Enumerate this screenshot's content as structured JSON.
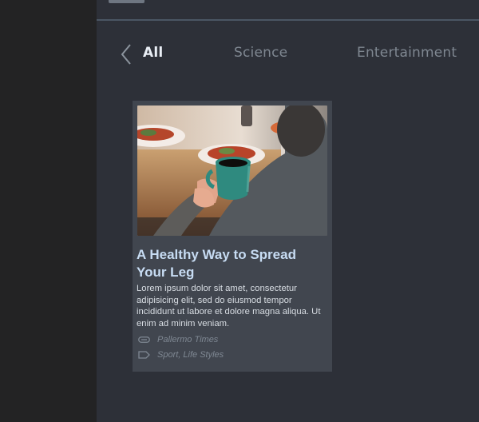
{
  "nav": {
    "tabs": [
      {
        "label": "All",
        "active": true
      },
      {
        "label": "Science",
        "active": false
      },
      {
        "label": "Entertainment",
        "active": false
      }
    ]
  },
  "card": {
    "title": "A Healthy Way to Spread Your Leg",
    "description": "Lorem ipsum dolor sit amet, consectetur adipisicing elit, sed do eiusmod tempor incididunt ut labore et dolore magna aliqua. Ut enim ad minim veniam.",
    "source": "Pallermo Times",
    "tags": "Sport, Life Styles",
    "source_icon": "link-icon",
    "tags_icon": "tag-icon"
  },
  "colors": {
    "sidebar": "#232324",
    "main_bg": "#2d3038",
    "card_bg": "#41464f",
    "title": "#c7dcf3",
    "active_tab": "#e9eef5",
    "inactive_tab": "#7f8791"
  }
}
